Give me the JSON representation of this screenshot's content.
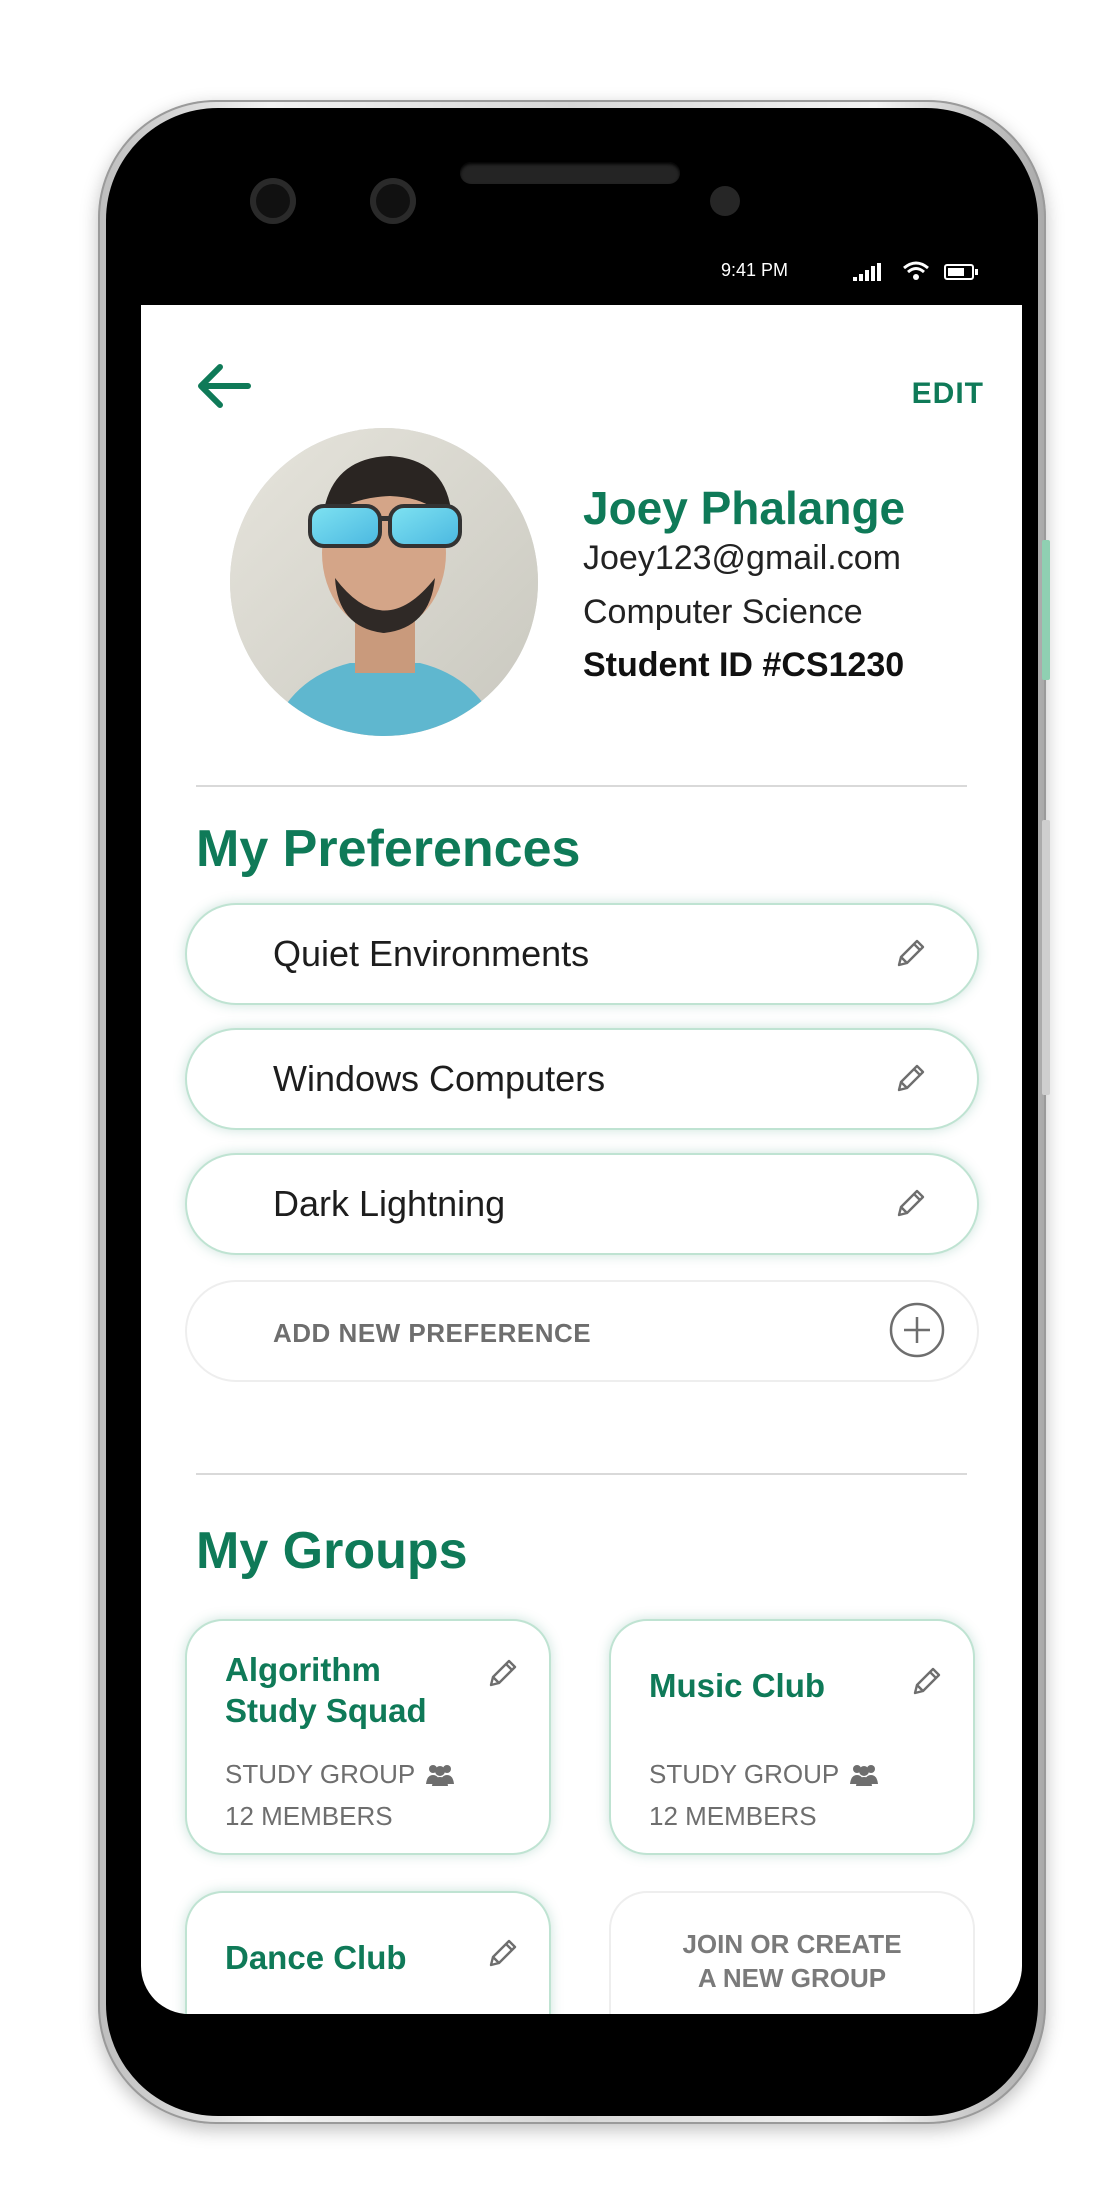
{
  "status_bar": {
    "time": "9:41 PM"
  },
  "header": {
    "edit_label": "EDIT"
  },
  "profile": {
    "name": "Joey Phalange",
    "email": "Joey123@gmail.com",
    "major": "Computer Science",
    "student_id": "Student ID  #CS1230"
  },
  "preferences": {
    "title": "My Preferences",
    "items": [
      {
        "label": "Quiet Environments"
      },
      {
        "label": "Windows Computers"
      },
      {
        "label": "Dark Lightning"
      }
    ],
    "add_label": "ADD NEW PREFERENCE"
  },
  "groups": {
    "title": "My Groups",
    "items": [
      {
        "name_line1": "Algorithm",
        "name_line2": "Study Squad",
        "type": "STUDY GROUP",
        "members": "12 MEMBERS"
      },
      {
        "name_line1": "Music Club",
        "name_line2": "",
        "type": "STUDY GROUP",
        "members": "12 MEMBERS"
      },
      {
        "name_line1": "Dance Club",
        "name_line2": "",
        "type": "",
        "members": ""
      }
    ],
    "join_line1": "JOIN OR CREATE",
    "join_line2": "A NEW GROUP"
  },
  "colors": {
    "accent": "#0f7a58",
    "card_border": "#bfe3d2",
    "muted_text": "#6e6e6e"
  },
  "icons": [
    "back-arrow-icon",
    "pencil-icon",
    "plus-circle-icon",
    "people-icon",
    "signal-icon",
    "wifi-icon",
    "battery-icon"
  ]
}
